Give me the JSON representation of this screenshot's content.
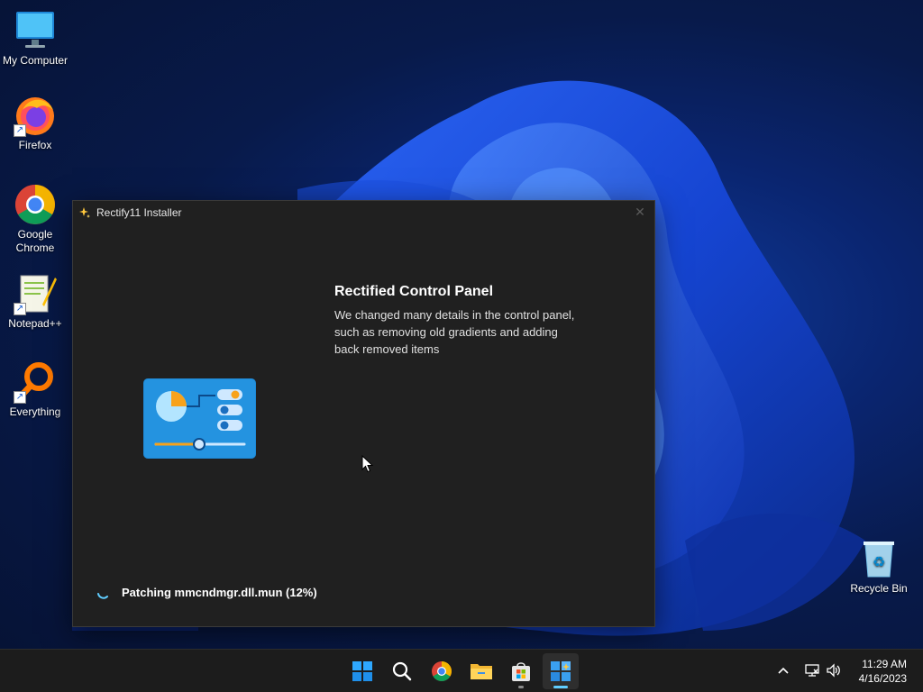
{
  "desktop": {
    "icons": [
      {
        "label": "My Computer"
      },
      {
        "label": "Firefox"
      },
      {
        "label": "Google Chrome"
      },
      {
        "label": "Notepad++"
      },
      {
        "label": "Everything"
      },
      {
        "label": "Recycle Bin"
      }
    ]
  },
  "installer": {
    "title": "Rectify11 Installer",
    "close_glyph": "✕",
    "feature_title": "Rectified Control Panel",
    "feature_description": "We changed many details in the control panel, such as removing old gradients and adding back removed items",
    "status_text": "Patching mmcndmgr.dll.mun (12%)"
  },
  "taskbar": {
    "apps": [
      "start-icon",
      "search-icon",
      "chrome-icon",
      "file-explorer-icon",
      "store-icon",
      "rectify11-installer-icon"
    ],
    "tray": [
      "chevron-up-icon",
      "network-icon",
      "volume-icon"
    ],
    "time": "11:29 AM",
    "date": "4/16/2023"
  },
  "colors": {
    "window_bg": "#202020",
    "accent": "#60cdff",
    "taskbar_bg": "#1c1c1c"
  }
}
